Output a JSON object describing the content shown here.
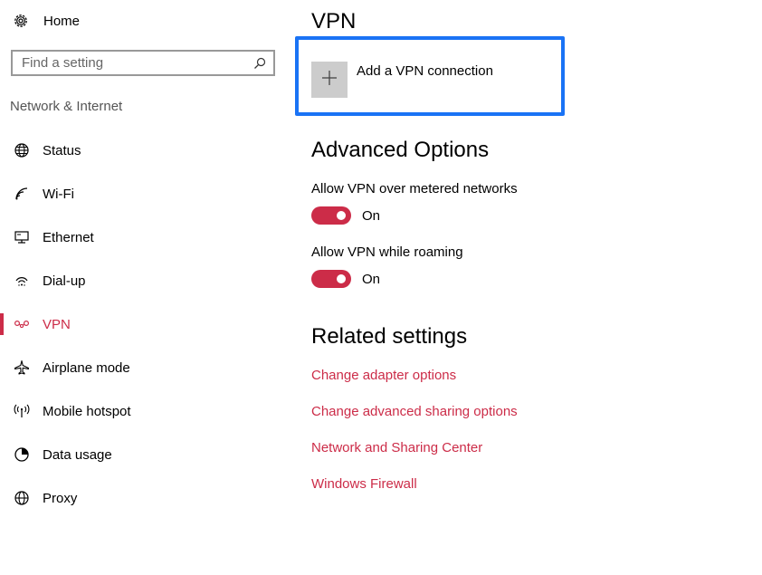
{
  "sidebar": {
    "home_label": "Home",
    "search": {
      "placeholder": "Find a setting",
      "value": ""
    },
    "section_header": "Network & Internet",
    "items": [
      {
        "label": "Status",
        "icon": "globe-status-icon",
        "active": false
      },
      {
        "label": "Wi-Fi",
        "icon": "wifi-icon",
        "active": false
      },
      {
        "label": "Ethernet",
        "icon": "ethernet-icon",
        "active": false
      },
      {
        "label": "Dial-up",
        "icon": "dialup-icon",
        "active": false
      },
      {
        "label": "VPN",
        "icon": "vpn-icon",
        "active": true
      },
      {
        "label": "Airplane mode",
        "icon": "airplane-icon",
        "active": false
      },
      {
        "label": "Mobile hotspot",
        "icon": "hotspot-icon",
        "active": false
      },
      {
        "label": "Data usage",
        "icon": "data-usage-icon",
        "active": false
      },
      {
        "label": "Proxy",
        "icon": "proxy-globe-icon",
        "active": false
      }
    ]
  },
  "main": {
    "title": "VPN",
    "add_vpn_label": "Add a VPN connection",
    "advanced": {
      "heading": "Advanced Options",
      "settings": [
        {
          "label": "Allow VPN over metered networks",
          "state": "On",
          "on": true
        },
        {
          "label": "Allow VPN while roaming",
          "state": "On",
          "on": true
        }
      ]
    },
    "related": {
      "heading": "Related settings",
      "links": [
        "Change adapter options",
        "Change advanced sharing options",
        "Network and Sharing Center",
        "Windows Firewall"
      ]
    }
  },
  "colors": {
    "accent": "#cc2c48",
    "highlight_border": "#1a73f5",
    "add_tile": "#cccccc"
  }
}
